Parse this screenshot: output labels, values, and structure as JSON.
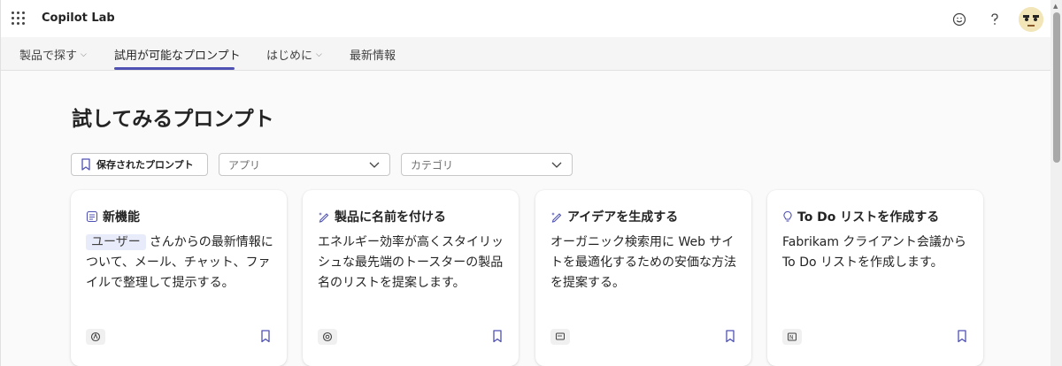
{
  "app": {
    "title": "Copilot Lab"
  },
  "header_icons": [
    "waffle-icon",
    "smiley-icon",
    "help-icon",
    "avatar"
  ],
  "nav": {
    "items": [
      {
        "label": "製品で探す",
        "has_chevron": true
      },
      {
        "label": "試用が可能なプロンプト",
        "has_chevron": false,
        "active": true
      },
      {
        "label": "はじめに",
        "has_chevron": true
      },
      {
        "label": "最新情報",
        "has_chevron": false
      }
    ]
  },
  "heading": "試してみるプロンプト",
  "filters": {
    "saved_label": "保存されたプロンプト",
    "app_placeholder": "アプリ",
    "category_placeholder": "カテゴリ"
  },
  "cards": [
    {
      "title": "新機能",
      "tag": "ユーザー",
      "description": "さんからの最新情報について、メール、チャット、ファイルで整理して提示する。",
      "title_icon": "list-icon",
      "app_icon": "m365-copilot-icon"
    },
    {
      "title": "製品に名前を付ける",
      "description": "エネルギー効率が高くスタイリッシュな最先端のトースターの製品名のリストを提案します。",
      "title_icon": "pen-sparkle-icon",
      "app_icon": "loop-icon"
    },
    {
      "title": "アイデアを生成する",
      "description": "オーガニック検索用に Web サイトを最適化するための安価な方法を提案する。",
      "title_icon": "pen-sparkle-icon",
      "app_icon": "whiteboard-icon"
    },
    {
      "title": "To Do リストを作成する",
      "description": "Fabrikam クライアント会議から To Do リストを作成します。",
      "title_icon": "lightbulb-icon",
      "app_icon": "onenote-icon"
    }
  ],
  "colors": {
    "accent": "#4f52b2",
    "tag_bg": "#e8ebfa",
    "page_bg": "#fafafa"
  }
}
